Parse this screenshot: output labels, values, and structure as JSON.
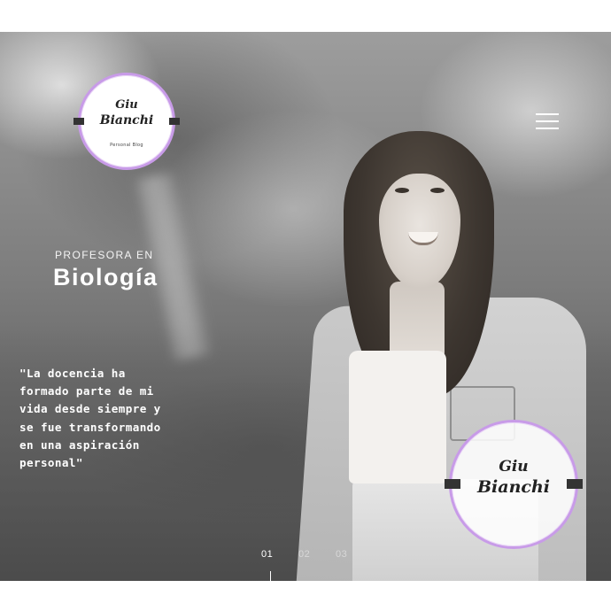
{
  "brand": {
    "logo_name_line1": "Giu",
    "logo_name_line2": "Bianchi",
    "logo_tagline": "Personal Blog",
    "accent_color": "#c89be8"
  },
  "header": {
    "menu_icon": "hamburger-menu-icon"
  },
  "hero": {
    "eyebrow": "PROFESORA EN",
    "headline": "Biología",
    "quote": "\"La docencia ha\nformado parte de mi\nvida desde siempre y\nse fue transformando\nen una aspiración\npersonal\""
  },
  "slider": {
    "pages": [
      "01",
      "02",
      "03"
    ],
    "active_index": 0
  }
}
